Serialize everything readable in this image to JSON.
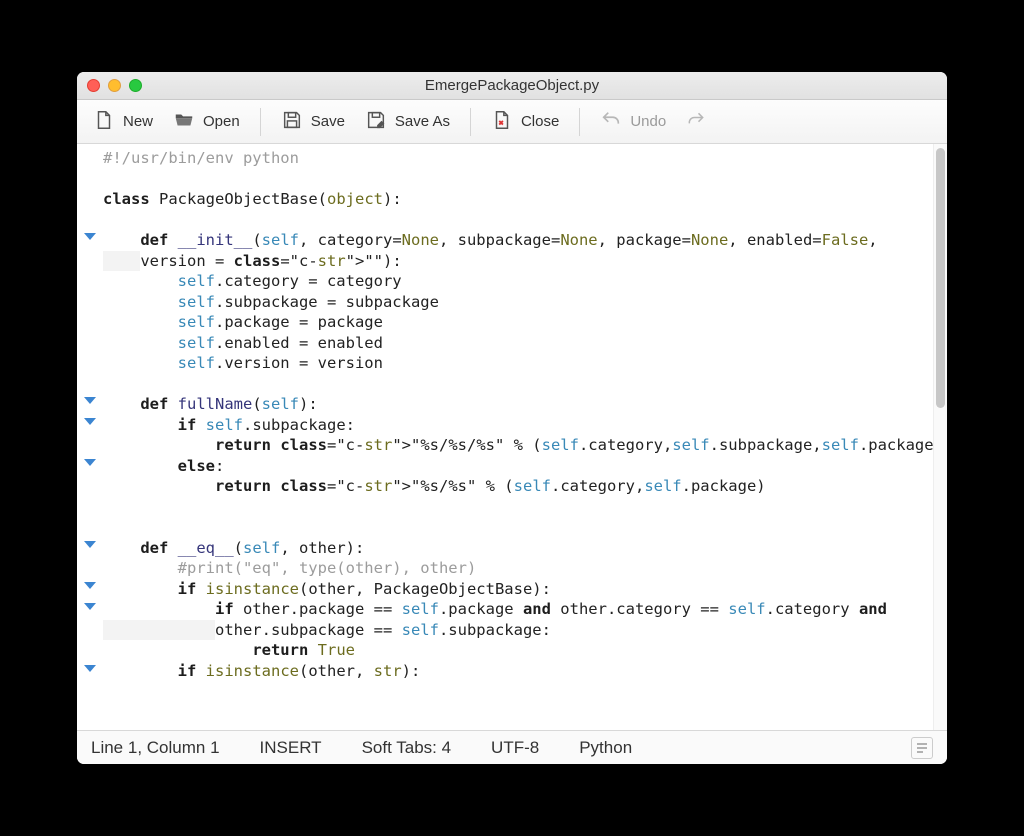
{
  "window": {
    "title": "EmergePackageObject.py"
  },
  "toolbar": {
    "new": "New",
    "open": "Open",
    "save": "Save",
    "save_as": "Save As",
    "close": "Close",
    "undo": "Undo"
  },
  "statusbar": {
    "position": "Line 1, Column 1",
    "mode": "INSERT",
    "indent": "Soft Tabs: 4",
    "encoding": "UTF-8",
    "language": "Python"
  },
  "code": {
    "lines": [
      "#!/usr/bin/env python",
      "",
      "class PackageObjectBase(object):",
      "",
      "    def __init__(self, category=None, subpackage=None, package=None, enabled=False, version = \"\"):",
      "        self.category = category",
      "        self.subpackage = subpackage",
      "        self.package = package",
      "        self.enabled = enabled",
      "        self.version = version",
      "",
      "    def fullName(self):",
      "        if self.subpackage:",
      "            return \"%s/%s/%s\" % (self.category,self.subpackage,self.package)",
      "        else:",
      "            return \"%s/%s\" % (self.category,self.package)",
      "",
      "",
      "    def __eq__(self, other):",
      "        #print(\"eq\", type(other), other)",
      "        if isinstance(other, PackageObjectBase):",
      "            if other.package == self.package and other.category == self.category and other.subpackage == self.subpackage:",
      "                return True",
      "        if isinstance(other, str):"
    ]
  }
}
